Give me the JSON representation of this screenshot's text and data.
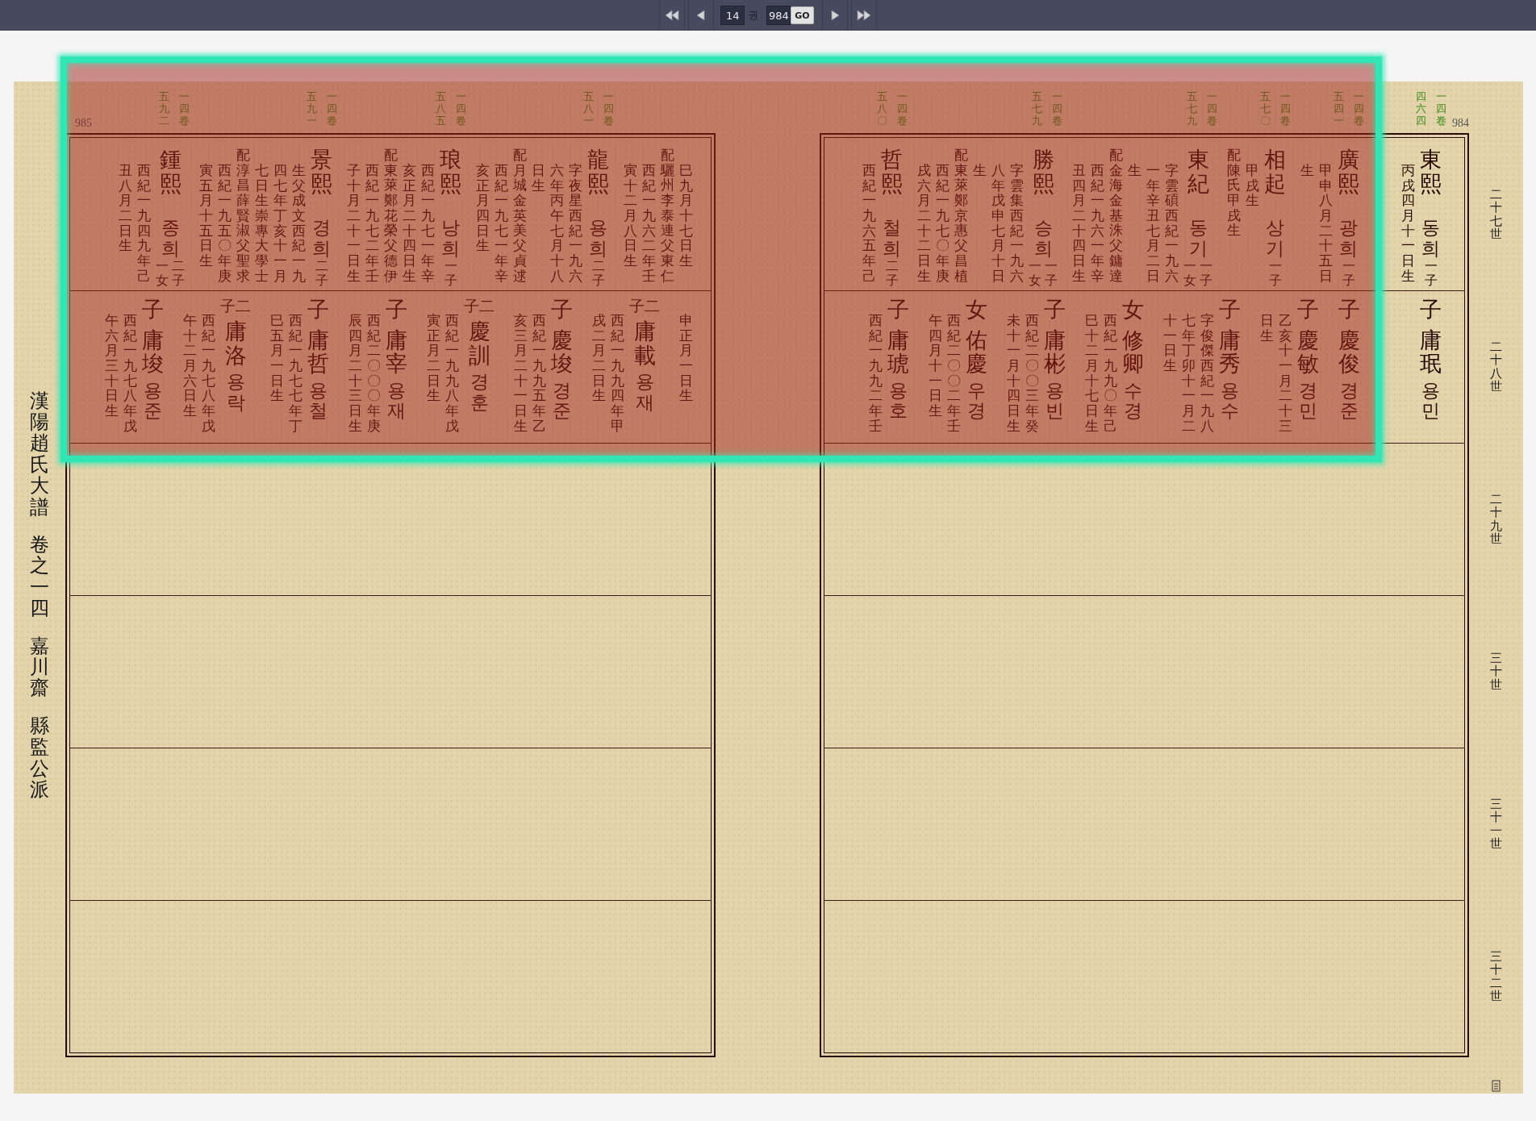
{
  "toolbar": {
    "controls": [
      {
        "kind": "first"
      },
      {
        "kind": "prev"
      },
      {
        "kind": "field",
        "value": "14"
      },
      {
        "kind": "label",
        "text": "권"
      },
      {
        "kind": "field",
        "value": "984"
      },
      {
        "kind": "go",
        "label": "GO"
      },
      {
        "kind": "next"
      },
      {
        "kind": "last"
      }
    ]
  },
  "selection_highlight": true,
  "title": [
    "漢陽趙氏大譜",
    "卷之一四",
    "嘉川齋",
    "縣監公派"
  ],
  "generations": [
    "二十七世",
    "二十八世",
    "二十九世",
    "三十世",
    "三十一世",
    "三十二世"
  ],
  "pages": [
    {
      "number": "985",
      "rows": [
        {
          "items": [
            {
              "kind": "person",
              "ref": {
                "page": "五九二",
                "volume": "一四卷"
              },
              "name": "鍾熙",
              "hangul": "종희",
              "issue": [
                "一女",
                "二子"
              ],
              "details": [
                "丑八月二日生",
                "西紀一九四九年己"
              ]
            },
            {
              "kind": "person",
              "ref": {
                "page": "五九一",
                "volume": "一四卷"
              },
              "name": "景熙",
              "hangul": "경희",
              "issue": [
                "二子"
              ],
              "spouse": [
                "寅五月十五日生",
                "西紀一九五〇年庚",
                "配淳昌薛賢淑父聖求"
              ],
              "details": [
                "七日生崇專大學士",
                "四七年丁亥十一月",
                "生父成文西紀一九"
              ]
            },
            {
              "kind": "person",
              "ref": {
                "page": "五八五",
                "volume": "一四卷"
              },
              "name": "琅熙",
              "hangul": "낭희",
              "issue": [
                "一子"
              ],
              "spouse": [
                "子十月二十一日生",
                "西紀一九七二年壬",
                "配東萊鄭花榮父德伊"
              ],
              "details": [
                "亥正月二十四日生",
                "西紀一九七一年辛"
              ]
            },
            {
              "kind": "person",
              "ref": {
                "page": "五八一",
                "volume": "一四卷"
              },
              "name": "龍熙",
              "hangul": "용희",
              "issue": [
                "二子"
              ],
              "spouse": [
                "亥正月四日生",
                "西紀一九七一年辛",
                "配月城金英美父貞逑"
              ],
              "details": [
                "日生",
                "六年丙午七月十八",
                "字夜星西紀一九六"
              ]
            },
            {
              "kind": "continuation",
              "spouse": [
                "寅十二月八日生",
                "西紀一九六二年壬",
                "配驪州李泰連父東仁"
              ],
              "details": [
                "巳九月十七日生"
              ]
            }
          ]
        },
        {
          "items": [
            {
              "kind": "child",
              "relation": "子",
              "name": "庸埈",
              "hangul": "용준",
              "details": [
                "午六月三十日生",
                "西紀一九七八年戊"
              ]
            },
            {
              "kind": "ordinal",
              "relation": "子二",
              "name": "庸洛",
              "hangul": "용락",
              "details": [
                "午十二月六日生",
                "西紀一九七八年戊"
              ]
            },
            {
              "kind": "child",
              "relation": "子",
              "name": "庸哲",
              "hangul": "용철",
              "details": [
                "巳五月一日生",
                "西紀一九七七年丁"
              ]
            },
            {
              "kind": "child",
              "relation": "子",
              "name": "庸宰",
              "hangul": "용재",
              "details": [
                "辰四月二十三日生",
                "西紀二〇〇〇年庚"
              ]
            },
            {
              "kind": "ordinal",
              "relation": "子二",
              "name": "慶訓",
              "hangul": "경훈",
              "details": [
                "寅正月二日生",
                "西紀一九九八年戊"
              ]
            },
            {
              "kind": "child",
              "relation": "子",
              "name": "慶埈",
              "hangul": "경준",
              "details": [
                "亥三月二十一日生",
                "西紀一九九五年乙"
              ]
            },
            {
              "kind": "ordinal",
              "relation": "子二",
              "name": "庸載",
              "hangul": "용재",
              "details": [
                "戌二月二日生",
                "西紀一九九四年甲"
              ]
            },
            {
              "kind": "continuation",
              "details": [
                "申正月一日生"
              ]
            }
          ]
        }
      ]
    },
    {
      "number": "984",
      "rows": [
        {
          "items": [
            {
              "kind": "person",
              "ref": {
                "page": "五八〇",
                "volume": "一四卷"
              },
              "name": "哲熙",
              "hangul": "철희",
              "issue": [
                "二子"
              ],
              "details": [
                "西紀一九六五年己"
              ]
            },
            {
              "kind": "person",
              "ref": {
                "page": "五七九",
                "volume": "一四卷"
              },
              "name": "勝熙",
              "hangul": "승희",
              "issue": [
                "一女",
                "一子"
              ],
              "spouse": [
                "戌六月二十二日生",
                "西紀一九七〇年庚",
                "配東萊鄭京惠父昌植"
              ],
              "details": [
                "生",
                "八年戊申七月十日",
                "字雲集西紀一九六"
              ]
            },
            {
              "kind": "person",
              "ref": {
                "page": "五七九",
                "volume": "一四卷"
              },
              "name": "東紀",
              "hangul": "동기",
              "issue": [
                "一女",
                "一子"
              ],
              "spouse": [
                "丑四月二十四日生",
                "西紀一九六一年辛",
                "配金海金基洙父鏞達"
              ],
              "details": [
                "生",
                "一年辛丑七月二日",
                "字雲碩西紀一九六"
              ]
            },
            {
              "kind": "person",
              "ref": {
                "page": "五七〇",
                "volume": "一四卷"
              },
              "name": "相起",
              "hangul": "상기",
              "issue": [
                "一子"
              ],
              "spouse": [
                "配陳氏甲戌生"
              ],
              "details": [
                "甲戌生"
              ]
            },
            {
              "kind": "person",
              "ref": {
                "page": "五四一",
                "volume": "一四卷"
              },
              "name": "廣熙",
              "hangul": "광희",
              "issue": [
                "一子"
              ],
              "details": [
                "生",
                "甲申八月二十五日"
              ]
            },
            {
              "kind": "person",
              "ref": {
                "page": "四六四",
                "volume": "一四卷"
              },
              "name": "東熙",
              "hangul": "동희",
              "issue": [
                "一子"
              ],
              "details": [
                "丙戌四月十一日生"
              ]
            }
          ]
        },
        {
          "items": [
            {
              "kind": "child",
              "relation": "子",
              "name": "庸琥",
              "hangul": "용호",
              "details": [
                "西紀一九九二年壬"
              ]
            },
            {
              "kind": "child",
              "relation": "女",
              "name": "佑慶",
              "hangul": "우경",
              "details": [
                "午四月十一日生",
                "西紀二〇〇二年壬"
              ]
            },
            {
              "kind": "child",
              "relation": "子",
              "name": "庸彬",
              "hangul": "용빈",
              "details": [
                "未十一月十四日生",
                "西紀二〇〇三年癸"
              ]
            },
            {
              "kind": "child",
              "relation": "女",
              "name": "修卿",
              "hangul": "수경",
              "details": [
                "巳十二月十七日生",
                "西紀一九九〇年己"
              ]
            },
            {
              "kind": "child",
              "relation": "子",
              "name": "庸秀",
              "hangul": "용수",
              "details": [
                "十一日生",
                "七年丁卯十一月二",
                "字俊傑西紀一九八"
              ]
            },
            {
              "kind": "child",
              "relation": "子",
              "name": "慶敏",
              "hangul": "경민",
              "details": [
                "日生",
                "乙亥十一月二十三"
              ]
            },
            {
              "kind": "child",
              "relation": "子",
              "name": "慶俊",
              "hangul": "경준"
            },
            {
              "kind": "child",
              "relation": "子",
              "name": "庸珉",
              "hangul": "용민"
            }
          ]
        }
      ]
    }
  ]
}
